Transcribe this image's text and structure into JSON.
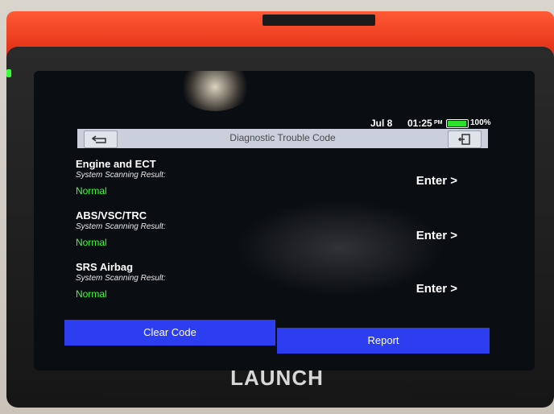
{
  "status_bar": {
    "date": "Jul 8",
    "time": "01:25",
    "meridiem": "PM",
    "battery": "100%"
  },
  "header": {
    "title": "Diagnostic Trouble Code",
    "back_icon": "return-arrow-icon",
    "exit_icon": "exit-door-icon"
  },
  "systems": [
    {
      "name": "Engine and ECT",
      "scan_label": "System Scanning Result:",
      "result": "Normal",
      "action": "Enter >"
    },
    {
      "name": "ABS/VSC/TRC",
      "scan_label": "System Scanning Result:",
      "result": "Normal",
      "action": "Enter >"
    },
    {
      "name": "SRS Airbag",
      "scan_label": "System Scanning Result:",
      "result": "Normal",
      "action": "Enter >"
    }
  ],
  "footer": {
    "clear_code": "Clear Code",
    "report": "Report"
  },
  "device": {
    "brand": "LAUNCH"
  },
  "colors": {
    "accent_button": "#2c3ef0",
    "result_ok": "#3cff3c",
    "titlebar": "#c9cfdb",
    "device_red": "#e8381c"
  }
}
